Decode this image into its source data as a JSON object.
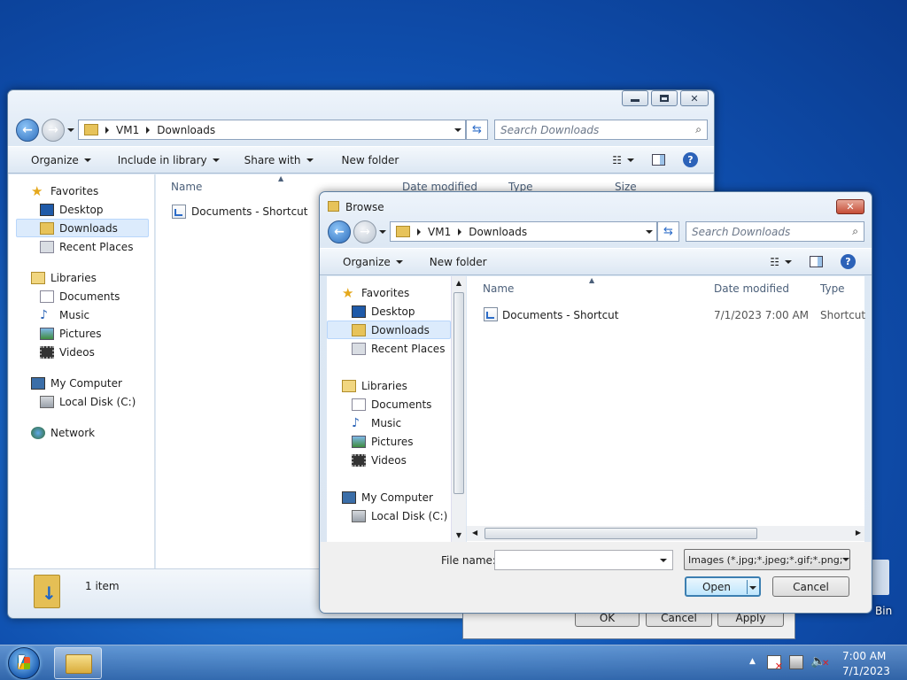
{
  "explorer": {
    "breadcrumb": [
      "VM1",
      "Downloads"
    ],
    "search_placeholder": "Search Downloads",
    "toolbar": [
      "Organize",
      "Include in library",
      "Share with",
      "New folder"
    ],
    "columns": [
      "Name",
      "Date modified",
      "Type",
      "Size"
    ],
    "nav": {
      "favorites": "Favorites",
      "desktop": "Desktop",
      "downloads": "Downloads",
      "recent": "Recent Places",
      "libraries": "Libraries",
      "documents": "Documents",
      "music": "Music",
      "pictures": "Pictures",
      "videos": "Videos",
      "computer": "My Computer",
      "localdisk": "Local Disk (C:)",
      "network": "Network"
    },
    "files": [
      {
        "name": "Documents - Shortcut"
      }
    ],
    "status": "1 item"
  },
  "props_dialog": {
    "ok": "OK",
    "cancel": "Cancel",
    "apply": "Apply"
  },
  "desktop": {
    "recycle_label": "Bin"
  },
  "browse": {
    "title": "Browse",
    "breadcrumb": [
      "VM1",
      "Downloads"
    ],
    "search_placeholder": "Search Downloads",
    "toolbar": [
      "Organize",
      "New folder"
    ],
    "columns": [
      "Name",
      "Date modified",
      "Type"
    ],
    "nav": {
      "favorites": "Favorites",
      "desktop": "Desktop",
      "downloads": "Downloads",
      "recent": "Recent Places",
      "libraries": "Libraries",
      "documents": "Documents",
      "music": "Music",
      "pictures": "Pictures",
      "videos": "Videos",
      "computer": "My Computer",
      "localdisk": "Local Disk (C:)"
    },
    "files": [
      {
        "name": "Documents - Shortcut",
        "date": "7/1/2023 7:00 AM",
        "type": "Shortcut"
      }
    ],
    "filename_label": "File name:",
    "filename_value": "",
    "filetype": "Images (*.jpg;*.jpeg;*.gif;*.png;",
    "open": "Open",
    "cancel": "Cancel"
  },
  "taskbar": {
    "time": "7:00 AM",
    "date": "7/1/2023"
  }
}
